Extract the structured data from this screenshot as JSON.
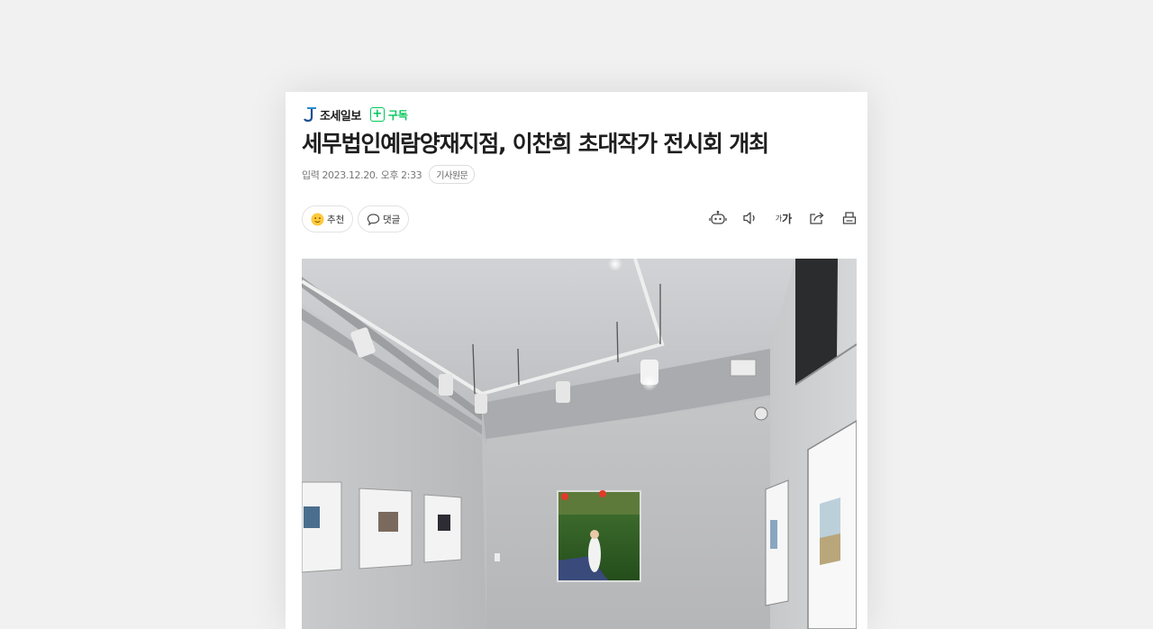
{
  "press": {
    "name": "조세일보",
    "logo_icon": "press-logo-icon"
  },
  "subscribe": {
    "label": "구독",
    "icon": "plus-square-icon",
    "color": "#03c75a"
  },
  "article": {
    "title": "세무법인예람양재지점, 이찬희 초대작가 전시회 개최",
    "published_label": "입력",
    "published_date": "2023.12.20. 오후 2:33",
    "original_button": "기사원문"
  },
  "actions": {
    "recommend": {
      "label": "추천",
      "icon": "smile-emoji-icon"
    },
    "comment": {
      "label": "댓글",
      "icon": "comment-bubble-icon"
    }
  },
  "toolbar": {
    "summary_icon": "robot-summary-icon",
    "listen_icon": "speaker-icon",
    "font_size_label": "가",
    "font_size_small": "가",
    "share_icon": "share-icon",
    "print_icon": "print-icon"
  },
  "photo": {
    "subject": "gallery-exhibition-photo"
  }
}
